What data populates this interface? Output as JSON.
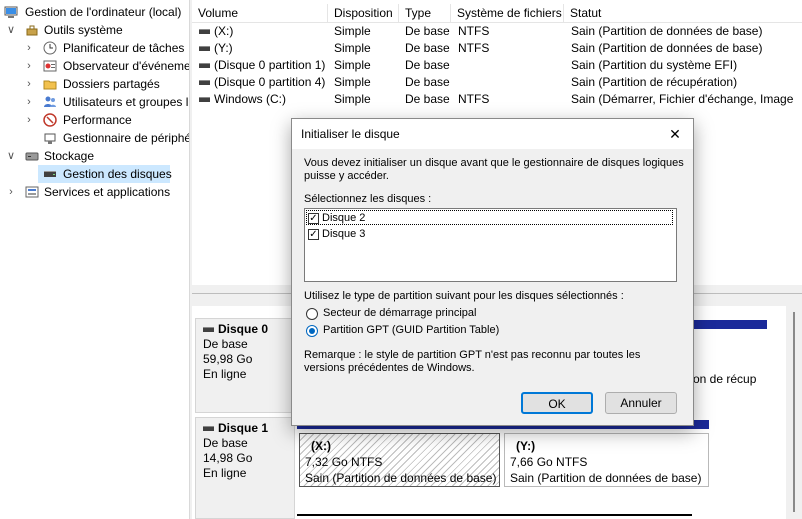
{
  "tree": {
    "items": [
      {
        "label": "Gestion de l'ordinateur (local)",
        "icon": "computer-icon",
        "chevron": ""
      },
      {
        "label": "Outils système",
        "icon": "tools-icon",
        "chevron": "∨"
      },
      {
        "label": "Planificateur de tâches",
        "icon": "clock-icon",
        "chevron": "›"
      },
      {
        "label": "Observateur d'événeme",
        "icon": "event-viewer-icon",
        "chevron": "›"
      },
      {
        "label": "Dossiers partagés",
        "icon": "shared-folder-icon",
        "chevron": "›"
      },
      {
        "label": "Utilisateurs et groupes l",
        "icon": "users-icon",
        "chevron": "›"
      },
      {
        "label": "Performance",
        "icon": "performance-icon",
        "chevron": "›"
      },
      {
        "label": "Gestionnaire de périphé",
        "icon": "device-manager-icon",
        "chevron": ""
      },
      {
        "label": "Stockage",
        "icon": "storage-icon",
        "chevron": "∨"
      },
      {
        "label": "Gestion des disques",
        "icon": "disk-management-icon",
        "chevron": ""
      },
      {
        "label": "Services et applications",
        "icon": "services-icon",
        "chevron": "›"
      }
    ]
  },
  "volume_list": {
    "columns": [
      "Volume",
      "Disposition",
      "Type",
      "Système de fichiers",
      "Statut"
    ],
    "rows": [
      {
        "volume": "(X:)",
        "layout": "Simple",
        "type": "De base",
        "fs": "NTFS",
        "status": "Sain (Partition de données de base)"
      },
      {
        "volume": "(Y:)",
        "layout": "Simple",
        "type": "De base",
        "fs": "NTFS",
        "status": "Sain (Partition de données de base)"
      },
      {
        "volume": "(Disque 0 partition 1)",
        "layout": "Simple",
        "type": "De base",
        "fs": "",
        "status": "Sain (Partition du système EFI)"
      },
      {
        "volume": "(Disque 0 partition 4)",
        "layout": "Simple",
        "type": "De base",
        "fs": "",
        "status": "Sain (Partition de récupération)"
      },
      {
        "volume": "Windows (C:)",
        "layout": "Simple",
        "type": "De base",
        "fs": "NTFS",
        "status": "Sain (Démarrer, Fichier d'échange, Image"
      }
    ]
  },
  "disks": [
    {
      "name": "Disque 0",
      "type": "De base",
      "size": "59,98 Go",
      "state": "En ligne",
      "visible_partition_text": "tion de récup"
    },
    {
      "name": "Disque 1",
      "type": "De base",
      "size": "14,98 Go",
      "state": "En ligne",
      "partitions": [
        {
          "name": "(X:)",
          "size": "7,32 Go NTFS",
          "status": "Sain (Partition de données de base)"
        },
        {
          "name": "(Y:)",
          "size": "7,66 Go NTFS",
          "status": "Sain (Partition de données de base)"
        }
      ]
    }
  ],
  "dialog": {
    "title": "Initialiser le disque",
    "intro": "Vous devez initialiser un disque avant que le gestionnaire de disques logiques puisse y accéder.",
    "select_label": "Sélectionnez les disques :",
    "disks": [
      {
        "label": "Disque 2",
        "checked": true
      },
      {
        "label": "Disque 3",
        "checked": true
      }
    ],
    "partition_style_label": "Utilisez le type de partition suivant pour les disques sélectionnés :",
    "options": [
      {
        "label": "Secteur de démarrage principal",
        "selected": false
      },
      {
        "label": "Partition GPT (GUID Partition Table)",
        "selected": true
      }
    ],
    "note": "Remarque : le style de partition GPT n'est pas reconnu par toutes les versions précédentes de Windows.",
    "ok_label": "OK",
    "cancel_label": "Annuler",
    "close_glyph": "✕"
  },
  "colors": {
    "accent": "#0078d7",
    "partition_bar": "#1b2a9a",
    "selection": "#cce8ff"
  }
}
